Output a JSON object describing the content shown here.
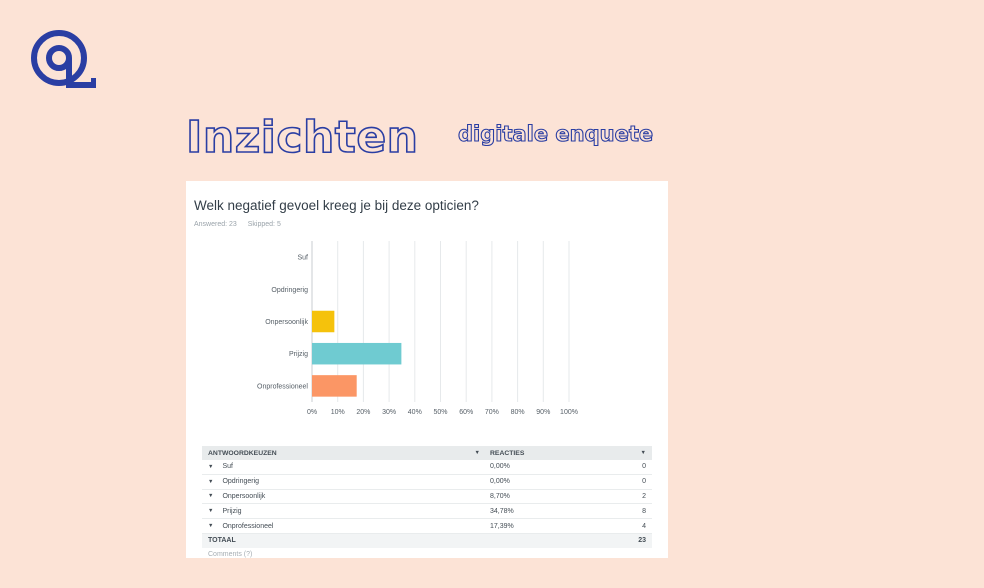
{
  "brand": {
    "logo_icon": "at-sign-logo-icon",
    "color": "#2a3ea3"
  },
  "hero": {
    "title": "Inzichten",
    "subtitle": "digitale enquete"
  },
  "question": {
    "title": "Welk negatief gevoel kreeg je bij deze opticien?",
    "answered_label": "Answered: 23",
    "skipped_label": "Skipped: 5"
  },
  "chart_data": {
    "type": "bar",
    "orientation": "horizontal",
    "categories": [
      "Suf",
      "Opdringerig",
      "Onpersoonlijk",
      "Prijzig",
      "Onprofessioneel"
    ],
    "values": [
      0,
      0,
      8.7,
      34.78,
      17.39
    ],
    "colors": [
      "#9ad0e4",
      "#ef7e8f",
      "#f5c20c",
      "#6fcbd1",
      "#fb9665"
    ],
    "xlim": [
      0,
      100
    ],
    "xticks": [
      "0%",
      "10%",
      "20%",
      "30%",
      "40%",
      "50%",
      "60%",
      "70%",
      "80%",
      "90%",
      "100%"
    ],
    "grid": true
  },
  "table": {
    "headers": {
      "choice": "ANTWOORDKEUZEN",
      "responses": "REACTIES"
    },
    "rows": [
      {
        "label": "Suf",
        "percent": "0,00%",
        "count": "0"
      },
      {
        "label": "Opdringerig",
        "percent": "0,00%",
        "count": "0"
      },
      {
        "label": "Onpersoonlijk",
        "percent": "8,70%",
        "count": "2"
      },
      {
        "label": "Prijzig",
        "percent": "34,78%",
        "count": "8"
      },
      {
        "label": "Onprofessioneel",
        "percent": "17,39%",
        "count": "4"
      }
    ],
    "total_label": "TOTAAL",
    "total_count": "23"
  },
  "footer_partial": "Comments (?)"
}
